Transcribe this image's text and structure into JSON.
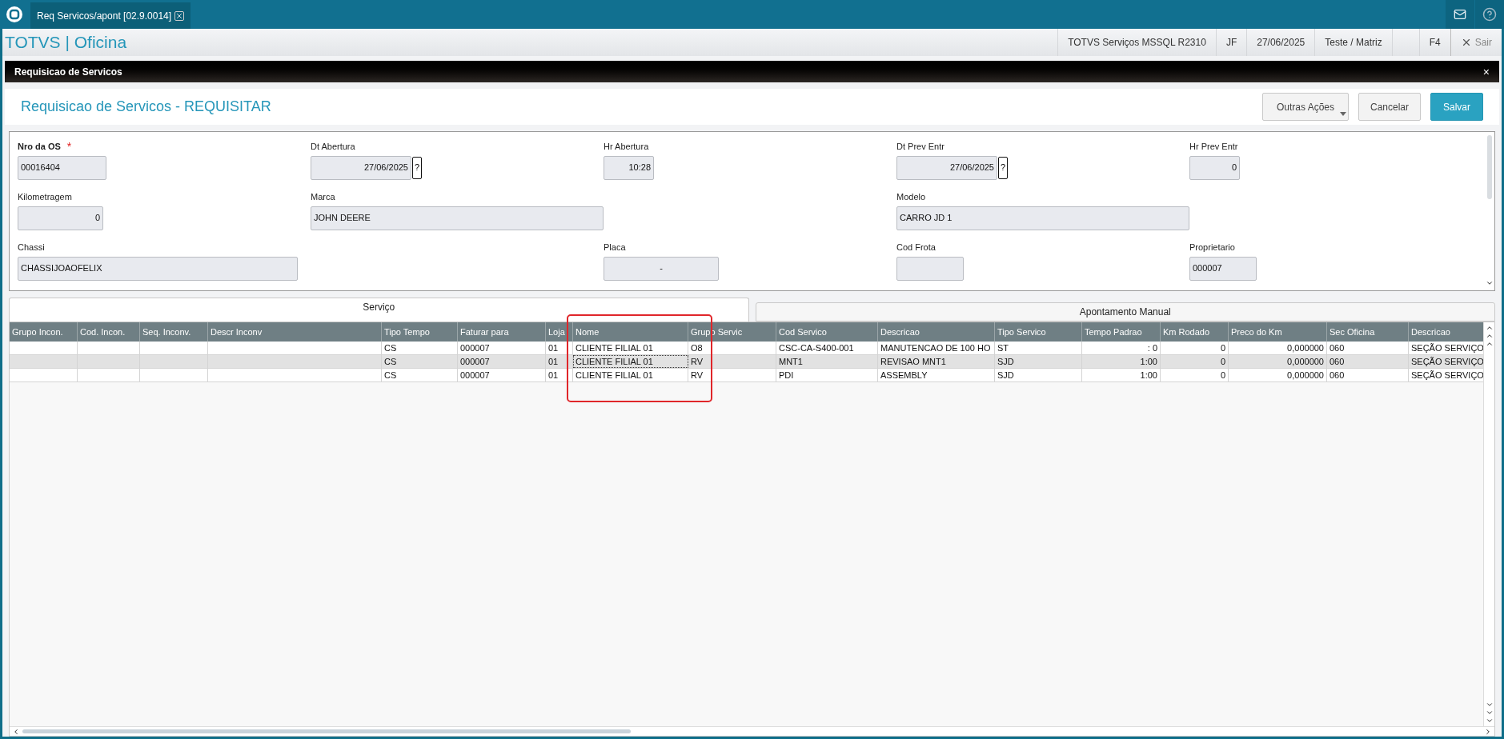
{
  "app_tab": {
    "label": "Req Servicos/apont [02.9.0014]"
  },
  "header": {
    "title": "TOTVS | Oficina",
    "info": [
      "TOTVS Serviços MSSQL R2310",
      "JF",
      "27/06/2025",
      "Teste / Matriz"
    ],
    "shortcut": "F4",
    "exit": "Sair"
  },
  "window": {
    "title": "Requisicao de Servicos",
    "close": "×"
  },
  "page": {
    "title": "Requisicao de Servicos - REQUISITAR",
    "buttons": [
      {
        "label": "Outras Ações",
        "kind": "menu"
      },
      {
        "label": "Cancelar",
        "kind": "plain"
      },
      {
        "label": "Salvar",
        "kind": "primary"
      }
    ]
  },
  "form": {
    "required_mark": "*",
    "fields": [
      {
        "label": "Nro da OS",
        "value": "00016404",
        "required": true
      },
      {
        "label": "Dt Abertura",
        "value": "27/06/2025",
        "required": false,
        "lookup_label": "?"
      },
      {
        "label": "Hr Abertura",
        "value": "10:28",
        "required": false
      },
      {
        "label": "Dt Prev Entr",
        "value": "27/06/2025",
        "required": false,
        "lookup_label": "?"
      },
      {
        "label": "Hr Prev Entr",
        "value": "0",
        "required": false
      },
      {
        "label": "Kilometragem",
        "value": "0",
        "required": false
      },
      {
        "label": "Marca",
        "value": "JOHN DEERE",
        "required": false
      },
      {
        "label": "Modelo",
        "value": "CARRO JD 1",
        "required": false
      },
      {
        "label": "Chassi",
        "value": "CHASSIJOAOFELIX",
        "required": false
      },
      {
        "label": "Placa",
        "value": "-",
        "required": false
      },
      {
        "label": "Cod Frota",
        "required": false
      },
      {
        "label": "Proprietario",
        "value": "000007",
        "required": false
      }
    ]
  },
  "tabs": [
    {
      "label": "Serviço",
      "selected": true
    },
    {
      "label": "Apontamento Manual",
      "selected": false
    }
  ],
  "table": {
    "columns": [
      "Grupo Incon.",
      "Cod. Incon.",
      "Seq. Inconv.",
      "Descr Inconv",
      "Tipo Tempo",
      "Faturar para",
      "Loja",
      "Nome",
      "Grupo Servic",
      "Cod Servico",
      "Descricao",
      "Tipo Servico",
      "Tempo Padrao",
      "Km Rodado",
      "Preco do Km",
      "Sec Oficina",
      "Descricao"
    ],
    "rows": [
      {
        "selected": false,
        "cells": [
          "",
          "",
          "",
          "",
          "CS",
          "000007",
          "01",
          "CLIENTE FILIAL 01",
          "O8",
          "CSC-CA-S400-001",
          "MANUTENCAO DE 100 HO",
          "ST",
          ": 0",
          "0",
          "0,000000",
          "060",
          "SEÇÃO SERVIÇO"
        ]
      },
      {
        "selected": true,
        "cells": [
          "",
          "",
          "",
          "",
          "CS",
          "000007",
          "01",
          "CLIENTE FILIAL 01",
          "RV",
          "MNT1",
          "REVISAO MNT1",
          "SJD",
          "1:00",
          "0",
          "0,000000",
          "060",
          "SEÇÃO SERVIÇO"
        ]
      },
      {
        "selected": false,
        "cells": [
          "",
          "",
          "",
          "",
          "CS",
          "000007",
          "01",
          "CLIENTE FILIAL 01",
          "RV",
          "PDI",
          "ASSEMBLY",
          "SJD",
          "1:00",
          "0",
          "0,000000",
          "060",
          "SEÇÃO SERVIÇO"
        ]
      }
    ]
  }
}
